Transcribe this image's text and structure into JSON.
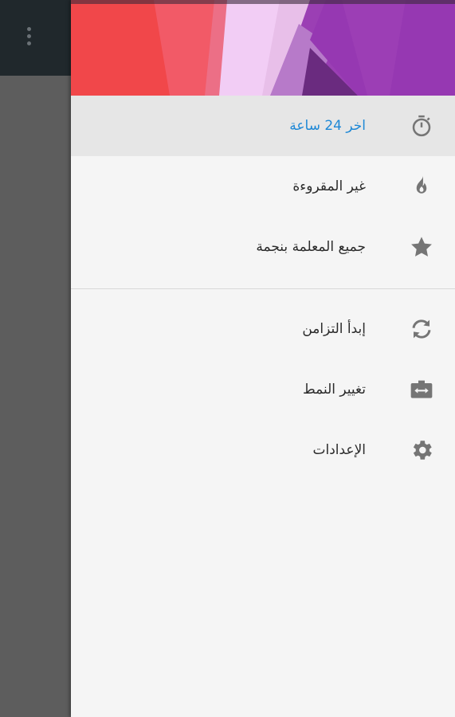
{
  "primary_items": [
    {
      "label": "اخر 24 ساعة",
      "icon": "timer-icon",
      "active": true
    },
    {
      "label": "غير المقروءة",
      "icon": "flame-icon",
      "active": false
    },
    {
      "label": "جميع المعلمة بنجمة",
      "icon": "star-icon",
      "active": false
    }
  ],
  "secondary_items": [
    {
      "label": "إبدأ التزامن",
      "icon": "sync-icon"
    },
    {
      "label": "تغيير النمط",
      "icon": "switch-layout-icon"
    },
    {
      "label": "الإعدادات",
      "icon": "gear-icon"
    }
  ],
  "colors": {
    "accent": "#1e88d6",
    "icon_gray": "#757575",
    "toolbar": "#20282c"
  }
}
